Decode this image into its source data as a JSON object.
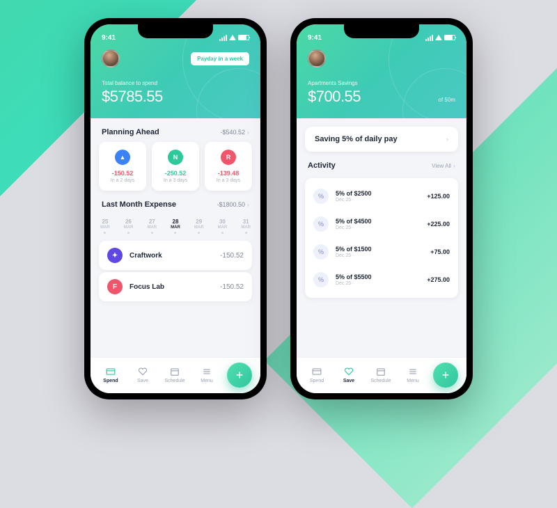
{
  "status": {
    "time": "9:41"
  },
  "phone1": {
    "pill": "Payday in a week",
    "balance_label": "Total balance to spend",
    "balance_value": "$5785.55",
    "planning": {
      "title": "Planning Ahead",
      "total": "-$540.52",
      "items": [
        {
          "color": "#3b82f6",
          "glyph": "▲",
          "value": "-150.52",
          "valColor": "red",
          "due": "In a 2 days"
        },
        {
          "color": "#2dc99b",
          "glyph": "N",
          "value": "-250.52",
          "valColor": "green",
          "due": "In a 3 days"
        },
        {
          "color": "#f0556b",
          "glyph": "R",
          "value": "-139.48",
          "valColor": "red",
          "due": "In a 3 days"
        }
      ]
    },
    "lastMonth": {
      "title": "Last Month Expense",
      "total": "-$1800.50",
      "dates": [
        {
          "n": "25",
          "m": "MAR",
          "a": false
        },
        {
          "n": "26",
          "m": "MAR",
          "a": false
        },
        {
          "n": "27",
          "m": "MAR",
          "a": false
        },
        {
          "n": "28",
          "m": "MAR",
          "a": true
        },
        {
          "n": "29",
          "m": "MAR",
          "a": false
        },
        {
          "n": "30",
          "m": "MAR",
          "a": false
        },
        {
          "n": "31",
          "m": "MAR",
          "a": false
        }
      ],
      "expenses": [
        {
          "color": "#5e47e3",
          "glyph": "✦",
          "name": "Craftwork",
          "value": "-150.52"
        },
        {
          "color": "#f0556b",
          "glyph": "F",
          "name": "Focus Lab",
          "value": "-150.52"
        }
      ]
    }
  },
  "phone2": {
    "balance_label": "Apartments Savings",
    "balance_value": "$700.55",
    "balance_of": "of 50m",
    "rule": "Saving 5% of daily pay",
    "activity": {
      "title": "Activity",
      "viewall": "View All",
      "items": [
        {
          "title": "5% of $2500",
          "date": "Dec 25",
          "value": "+125.00"
        },
        {
          "title": "5% of $4500",
          "date": "Dec 25",
          "value": "+225.00"
        },
        {
          "title": "5% of $1500",
          "date": "Dec 25",
          "value": "+75.00"
        },
        {
          "title": "5% of $5500",
          "date": "Dec 25",
          "value": "+275.00"
        }
      ]
    }
  },
  "tabs": {
    "spend": "Spend",
    "save": "Save",
    "schedule": "Schedule",
    "menu": "Menu"
  }
}
